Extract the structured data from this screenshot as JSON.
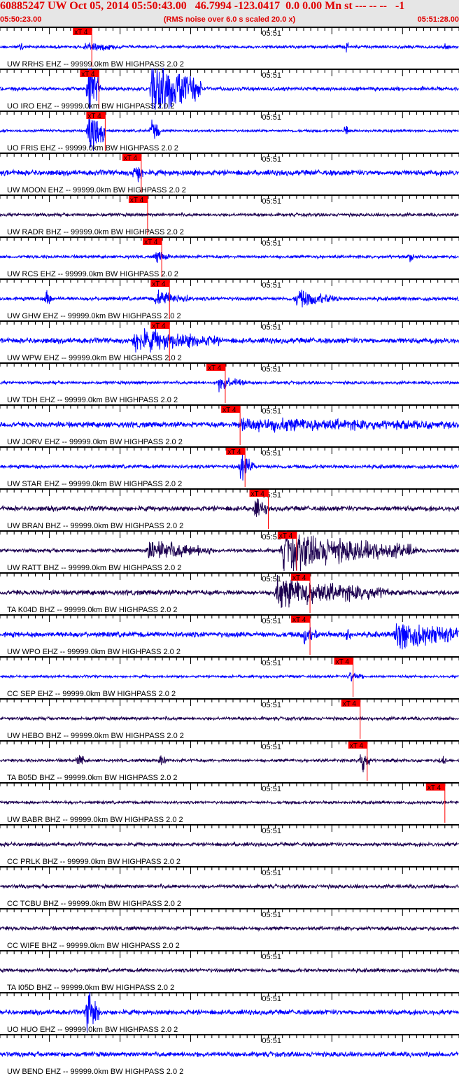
{
  "header": {
    "title": "60885247 UW Oct 05, 2014 05:50:43.00   46.7994 -123.0417  0.0 0.00 Mn st --- -- --   -1",
    "start_time": "05:50:23.00",
    "end_time": "05:51:28.00",
    "note": "(RMS noise over 6.0 s scaled 20.0 x)"
  },
  "chart_data": {
    "type": "line",
    "title": "Seismogram record section",
    "x_range_seconds": [
      0,
      65
    ],
    "minute_tick_label": "05:51",
    "minute_tick_seconds": 37,
    "pick_label": "xT 4",
    "colors": {
      "EHZ": "#0000ff",
      "BHZ": "#1c0050",
      "pick": "#ff0000"
    },
    "traces": [
      {
        "label": "UW RRHS EHZ -- 99999.0km BW  HIGHPASS  2.0  2",
        "comp": "EHZ",
        "pick": 13.0,
        "noise": 0.12,
        "bursts": [
          [
            12,
            5,
            0.35
          ],
          [
            3,
            0.3,
            0.8
          ],
          [
            49,
            0.3,
            0.6
          ],
          [
            63,
            0.5,
            0.3
          ]
        ]
      },
      {
        "label": "UO IRO EHZ -- 99999.0km BW  HIGHPASS  2.0  2",
        "comp": "EHZ",
        "pick": 14.0,
        "noise": 0.15,
        "bursts": [
          [
            12.5,
            1.8,
            3.0
          ],
          [
            21.5,
            7,
            3.0
          ]
        ]
      },
      {
        "label": "UO FRIS EHZ -- 99999.0km BW  HIGHPASS  2.0  2",
        "comp": "EHZ",
        "pick": 14.9,
        "noise": 0.1,
        "bursts": [
          [
            12.5,
            2.5,
            2.5
          ],
          [
            21.5,
            1.2,
            1.2
          ],
          [
            49,
            0.4,
            1.0
          ]
        ]
      },
      {
        "label": "UW MOON EHZ -- 99999.0km BW  HIGHPASS  2.0  2",
        "comp": "EHZ",
        "pick": 20.0,
        "noise": 0.22,
        "bursts": [
          [
            19,
            1.5,
            1.0
          ]
        ]
      },
      {
        "label": "UW RADR BHZ -- 99999.0km BW  HIGHPASS  2.0  2",
        "comp": "BHZ",
        "pick": 20.9,
        "noise": 0.13,
        "bursts": []
      },
      {
        "label": "UW RCS EHZ -- 99999.0km BW  HIGHPASS  2.0  2",
        "comp": "EHZ",
        "pick": 22.9,
        "noise": 0.12,
        "bursts": [
          [
            22,
            2,
            0.5
          ],
          [
            58,
            0.6,
            0.4
          ]
        ]
      },
      {
        "label": "UW GHW EHZ -- 99999.0km BW  HIGHPASS  2.0  2",
        "comp": "EHZ",
        "pick": 24.0,
        "noise": 0.15,
        "bursts": [
          [
            6.5,
            1,
            0.8
          ],
          [
            22,
            5,
            0.6
          ],
          [
            42,
            6,
            0.7
          ]
        ]
      },
      {
        "label": "UW WPW EHZ -- 99999.0km BW  HIGHPASS  2.0  2",
        "comp": "EHZ",
        "pick": 24.0,
        "noise": 0.22,
        "bursts": [
          [
            19,
            12,
            0.9
          ]
        ]
      },
      {
        "label": "UW TDH EHZ -- 99999.0km BW  HIGHPASS  2.0  2",
        "comp": "EHZ",
        "pick": 31.9,
        "noise": 0.12,
        "bursts": [
          [
            31,
            4,
            0.6
          ]
        ]
      },
      {
        "label": "UW JORV EHZ -- 99999.0km BW  HIGHPASS  2.0  2",
        "comp": "EHZ",
        "pick": 34.0,
        "noise": 0.22,
        "bursts": [
          [
            34,
            31,
            0.45
          ]
        ]
      },
      {
        "label": "UW STAR EHZ -- 99999.0km BW  HIGHPASS  2.0  2",
        "comp": "EHZ",
        "pick": 34.7,
        "noise": 0.15,
        "bursts": [
          [
            34,
            2,
            1.2
          ]
        ]
      },
      {
        "label": "UW BRAN BHZ -- 99999.0km BW  HIGHPASS  2.0  2",
        "comp": "BHZ",
        "pick": 38.0,
        "noise": 0.2,
        "bursts": [
          [
            36,
            2,
            0.8
          ]
        ]
      },
      {
        "label": "UW RATT BHZ -- 99999.0km BW  HIGHPASS  2.0  2",
        "comp": "BHZ",
        "pick": 42.0,
        "noise": 0.15,
        "bursts": [
          [
            21,
            9,
            0.9
          ],
          [
            40,
            19,
            1.6
          ]
        ]
      },
      {
        "label": "TA K04D BHZ -- 99999.0km BW  HIGHPASS  2.0  2",
        "comp": "BHZ",
        "pick": 43.9,
        "noise": 0.2,
        "bursts": [
          [
            39,
            16,
            1.2
          ]
        ]
      },
      {
        "label": "UW WPO EHZ -- 99999.0km BW  HIGHPASS  2.0  2",
        "comp": "EHZ",
        "pick": 43.9,
        "noise": 0.22,
        "bursts": [
          [
            43,
            2,
            0.8
          ],
          [
            49,
            0.6,
            0.9
          ],
          [
            56,
            9,
            1.3
          ]
        ]
      },
      {
        "label": "CC SEP EHZ -- 99999.0km BW  HIGHPASS  2.0  2",
        "comp": "EHZ",
        "pick": 50.0,
        "noise": 0.1,
        "bursts": [
          [
            49.5,
            2,
            0.5
          ]
        ]
      },
      {
        "label": "UW HEBO BHZ -- 99999.0km BW  HIGHPASS  2.0  2",
        "comp": "BHZ",
        "pick": 51.0,
        "noise": 0.13,
        "bursts": []
      },
      {
        "label": "TA B05D BHZ -- 99999.0km BW  HIGHPASS  2.0  2",
        "comp": "BHZ",
        "pick": 52.0,
        "noise": 0.12,
        "bursts": [
          [
            11,
            1,
            0.7
          ],
          [
            22.5,
            1,
            0.6
          ],
          [
            51,
            1.5,
            1.2
          ],
          [
            62.5,
            0.8,
            0.6
          ]
        ]
      },
      {
        "label": "UW BABR BHZ -- 99999.0km BW  HIGHPASS  2.0  2",
        "comp": "BHZ",
        "pick": 63.0,
        "noise": 0.12,
        "bursts": []
      },
      {
        "label": "CC PRLK BHZ -- 99999.0km BW  HIGHPASS  2.0  2",
        "comp": "BHZ",
        "pick": null,
        "noise": 0.15,
        "bursts": []
      },
      {
        "label": "CC TCBU BHZ -- 99999.0km BW  HIGHPASS  2.0  2",
        "comp": "BHZ",
        "pick": null,
        "noise": 0.15,
        "bursts": []
      },
      {
        "label": "CC WIFE BHZ -- 99999.0km BW  HIGHPASS  2.0  2",
        "comp": "BHZ",
        "pick": null,
        "noise": 0.15,
        "bursts": []
      },
      {
        "label": "TA I05D BHZ -- 99999.0km BW  HIGHPASS  2.0  2",
        "comp": "BHZ",
        "pick": null,
        "noise": 0.15,
        "bursts": []
      },
      {
        "label": "UO HUO EHZ -- 99999.0km BW  HIGHPASS  2.0  2",
        "comp": "EHZ",
        "pick": null,
        "noise": 0.2,
        "bursts": [
          [
            12.3,
            1.8,
            2.5
          ]
        ]
      },
      {
        "label": "UW BEND EHZ -- 99999.0km BW  HIGHPASS  2.0  2",
        "comp": "EHZ",
        "pick": null,
        "noise": 0.2,
        "bursts": []
      }
    ]
  }
}
